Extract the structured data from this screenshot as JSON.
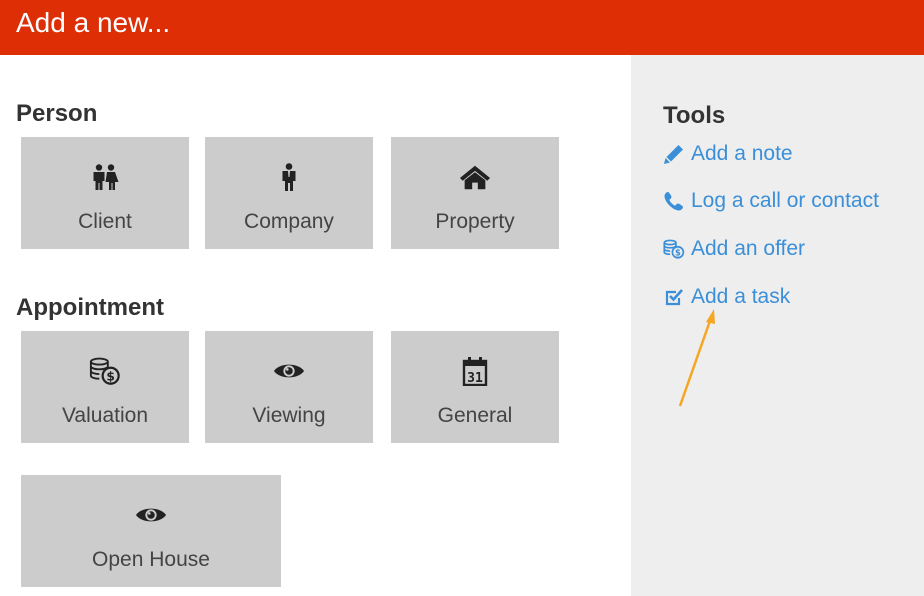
{
  "header": {
    "title": "Add a new..."
  },
  "person": {
    "title": "Person",
    "tiles": [
      {
        "label": "Client",
        "icon": "people-icon"
      },
      {
        "label": "Company",
        "icon": "person-icon"
      },
      {
        "label": "Property",
        "icon": "home-icon"
      }
    ]
  },
  "appointment": {
    "title": "Appointment",
    "tiles": [
      {
        "label": "Valuation",
        "icon": "coins-icon"
      },
      {
        "label": "Viewing",
        "icon": "eye-icon"
      },
      {
        "label": "General",
        "icon": "calendar-icon",
        "calendar_day": "31"
      },
      {
        "label": "Open House",
        "icon": "eye-icon"
      }
    ]
  },
  "tools": {
    "title": "Tools",
    "links": [
      {
        "label": "Add a note",
        "icon": "pencil-icon"
      },
      {
        "label": "Log a call or contact",
        "icon": "phone-icon"
      },
      {
        "label": "Add an offer",
        "icon": "coins-icon"
      },
      {
        "label": "Add a task",
        "icon": "checkbox-icon"
      }
    ]
  },
  "colors": {
    "header": "#dd2e06",
    "tile": "#cccccc",
    "sidebar": "#eeeeee",
    "link": "#3a8fd8",
    "annotation_arrow": "#f5a623"
  }
}
